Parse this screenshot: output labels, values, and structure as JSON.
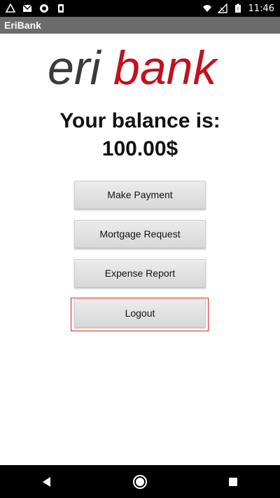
{
  "status_bar": {
    "time": "11:46",
    "icons": [
      "drive-icon",
      "gmail-icon",
      "circle-app-icon",
      "sim-icon",
      "wifi-icon",
      "no-signal-icon",
      "battery-icon"
    ]
  },
  "app_bar": {
    "title": "EriBank"
  },
  "logo": {
    "text_eri": "eri",
    "text_bank": "bank",
    "colors": {
      "eri": "#3a3a3a",
      "bank": "#c1121f"
    }
  },
  "balance": {
    "label": "Your balance is:",
    "value": "100.00$"
  },
  "buttons": {
    "make_payment": "Make Payment",
    "mortgage_request": "Mortgage Request",
    "expense_report": "Expense Report",
    "logout": "Logout"
  },
  "highlight": {
    "target": "logout-button",
    "color": "#e02020"
  },
  "nav_bar": {
    "buttons": [
      "back-icon",
      "home-icon",
      "recents-icon"
    ]
  }
}
